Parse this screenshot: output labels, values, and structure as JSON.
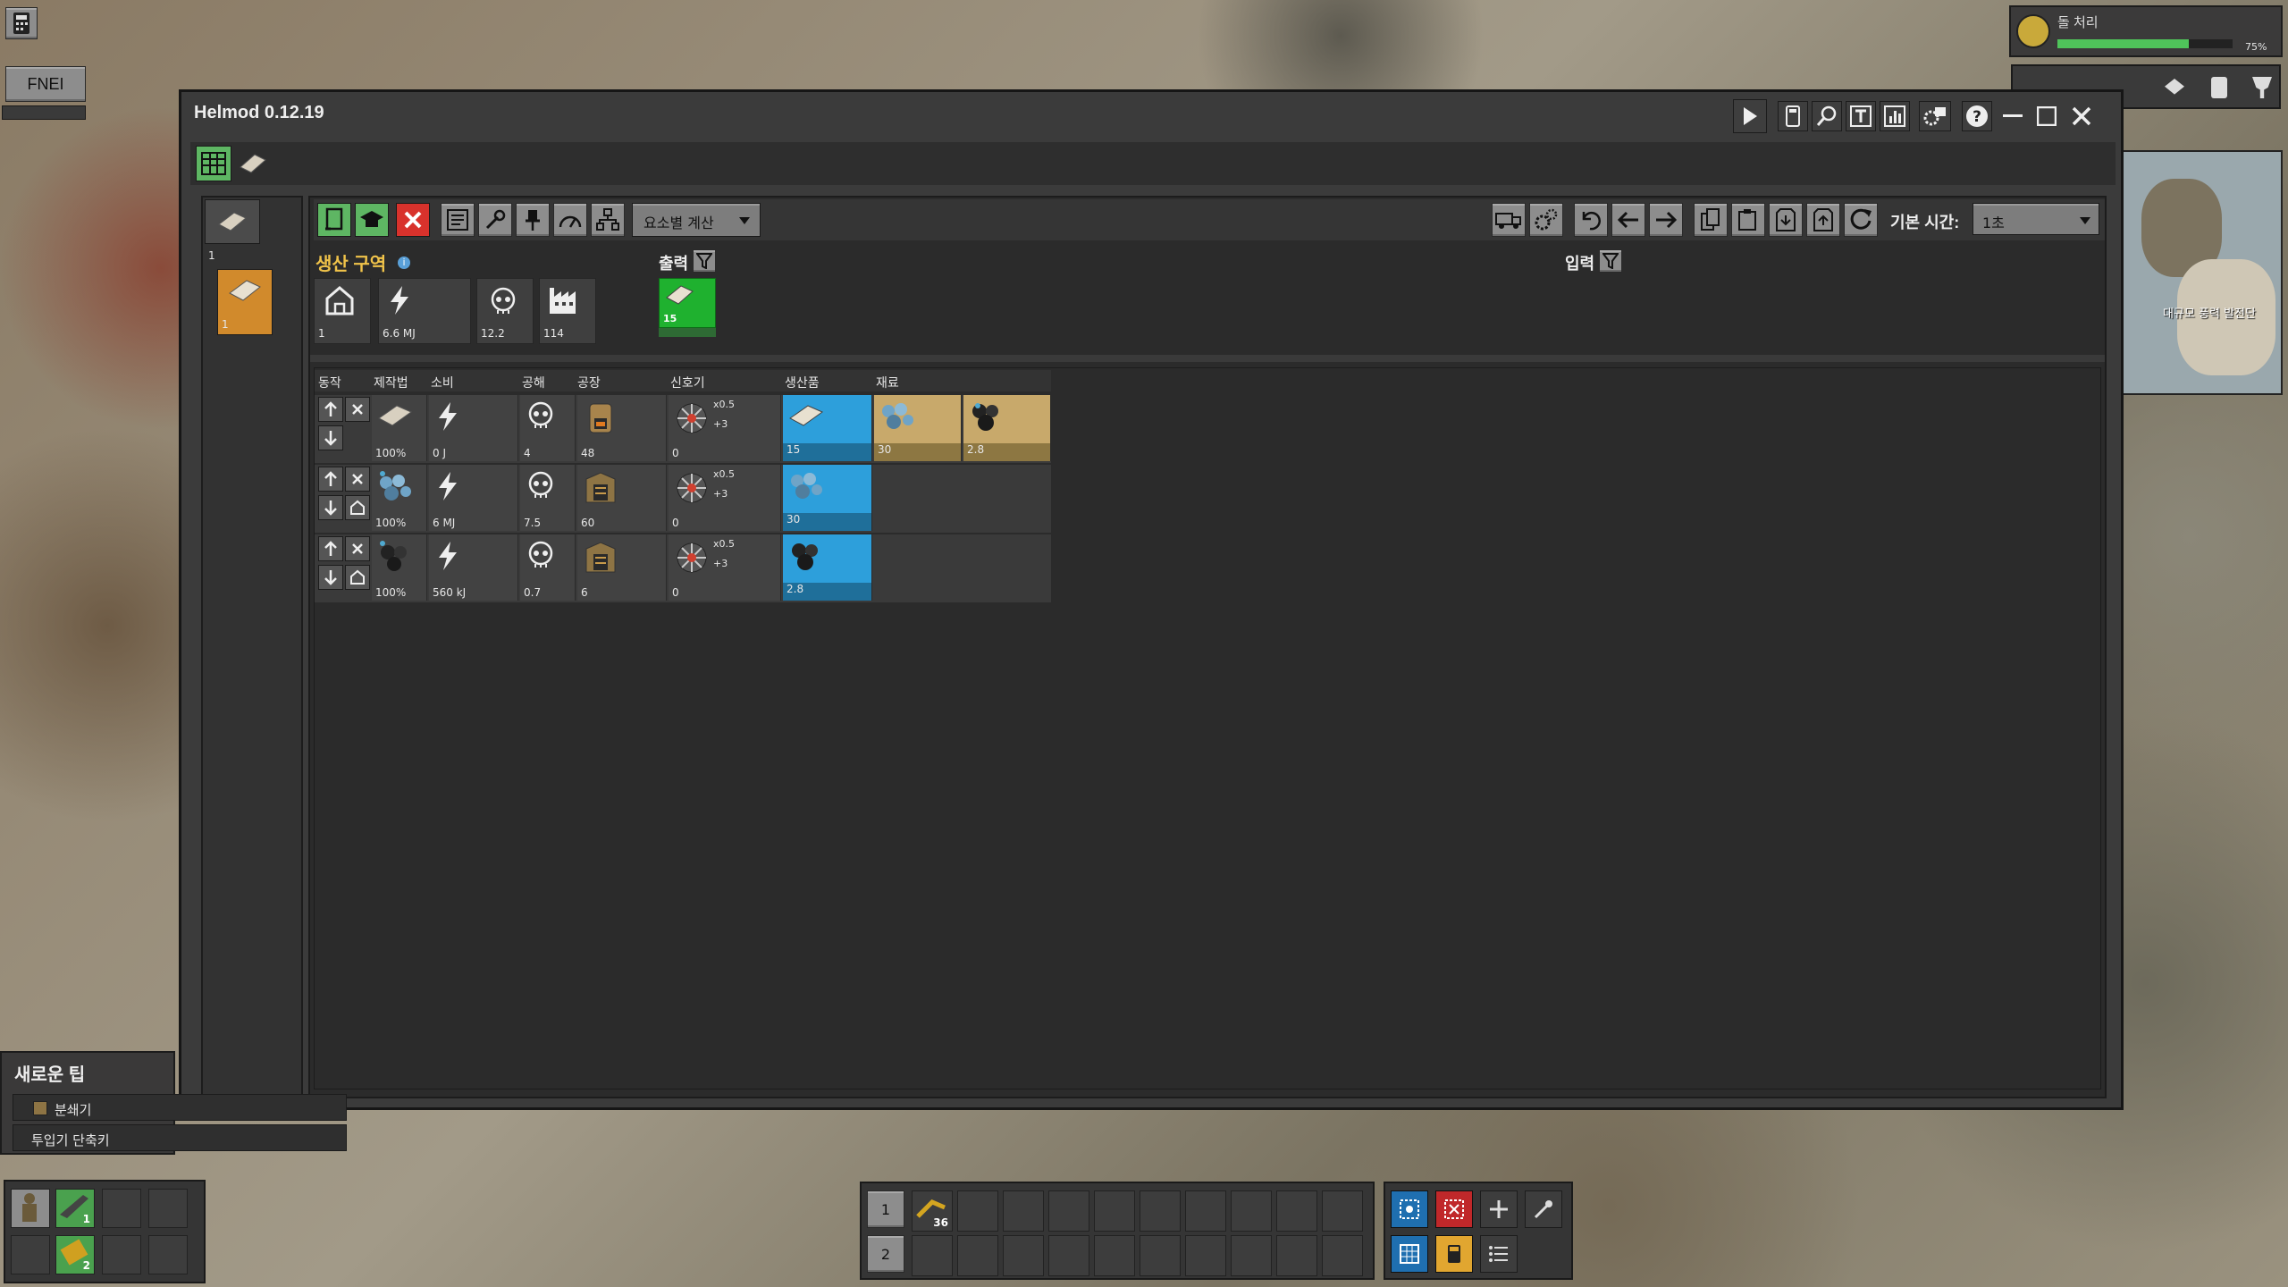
{
  "app": {
    "title": "Helmod 0.12.19",
    "fnei_label": "FNEI"
  },
  "research": {
    "name": "돌 처리",
    "percent": "75%",
    "progress": 0.75
  },
  "minimap": {
    "label": "대규모 풍력 발전단"
  },
  "tips": {
    "title": "새로운 팁",
    "items": [
      {
        "label": "분쇄기"
      },
      {
        "label": "투입기 단축키"
      }
    ]
  },
  "toolbar": {
    "mode_select": "요소별 계산",
    "base_time_label": "기본 시간:",
    "base_time_value": "1초"
  },
  "sidebar": {
    "block1_count": "1",
    "block2_count": "1"
  },
  "production": {
    "title": "생산 구역",
    "output_label": "출력",
    "input_label": "입력",
    "summary": [
      {
        "icon": "home-icon",
        "value": "1"
      },
      {
        "icon": "lightning-icon",
        "value": "6.6 MJ"
      },
      {
        "icon": "skull-icon",
        "value": "12.2"
      },
      {
        "icon": "factory-icon",
        "value": "114"
      }
    ],
    "output_value": "15"
  },
  "table": {
    "headers": [
      "동작",
      "제작법",
      "소비",
      "공해",
      "공장",
      "신호기",
      "생산품",
      "재료"
    ],
    "rows": [
      {
        "recipe_pct": "100%",
        "energy": "0 J",
        "pollution": "4",
        "factory": "48",
        "beacon_mult": "x0.5",
        "beacon_count": "+3",
        "beacon": "0",
        "product": "15",
        "ingredients": [
          "30",
          "2.8"
        ]
      },
      {
        "recipe_pct": "100%",
        "energy": "6 MJ",
        "pollution": "7.5",
        "factory": "60",
        "beacon_mult": "x0.5",
        "beacon_count": "+3",
        "beacon": "0",
        "product": "30",
        "ingredients": []
      },
      {
        "recipe_pct": "100%",
        "energy": "560 kJ",
        "pollution": "0.7",
        "factory": "6",
        "beacon_mult": "x0.5",
        "beacon_count": "+3",
        "beacon": "0",
        "product": "2.8",
        "ingredients": []
      }
    ]
  },
  "hotbar": {
    "row1": "1",
    "row2": "2",
    "item_count": "36"
  },
  "quickbar": {
    "slot1_count": "1",
    "slot2_count": "2"
  },
  "colors": {
    "accent_green": "#5eb663",
    "product_blue": "#2d9fdb",
    "ingredient_tan": "#c8a96b",
    "close_red": "#d8322c"
  }
}
